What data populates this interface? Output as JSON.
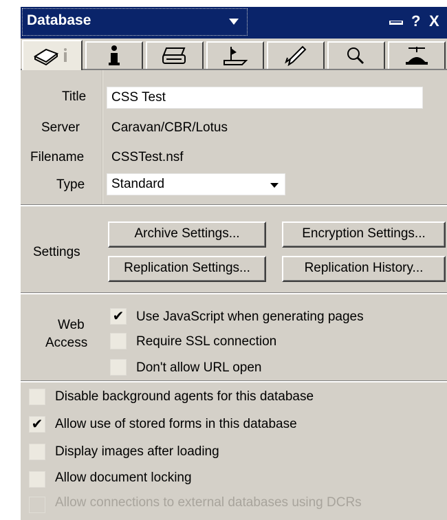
{
  "header": {
    "db_select": "Database",
    "help_glyph": "?",
    "close_glyph": "X"
  },
  "tabs": [
    {
      "name": "basics",
      "icon": "book-info-icon"
    },
    {
      "name": "info",
      "icon": "info-icon"
    },
    {
      "name": "print",
      "icon": "printer-icon"
    },
    {
      "name": "design",
      "icon": "design-icon"
    },
    {
      "name": "launch",
      "icon": "rocket-icon"
    },
    {
      "name": "fulltext",
      "icon": "magnifier-icon"
    },
    {
      "name": "advanced",
      "icon": "propeller-hat-icon"
    }
  ],
  "basics": {
    "title_label": "Title",
    "title_value": "CSS Test",
    "server_label": "Server",
    "server_value": "Caravan/CBR/Lotus",
    "filename_label": "Filename",
    "filename_value": "CSSTest.nsf",
    "type_label": "Type",
    "type_value": "Standard"
  },
  "settings": {
    "label": "Settings",
    "archive": "Archive Settings...",
    "encryption": "Encryption Settings...",
    "replication": "Replication Settings...",
    "history": "Replication History..."
  },
  "web_access": {
    "label_line1": "Web",
    "label_line2": "Access",
    "options": [
      {
        "label": "Use JavaScript when generating pages",
        "checked": true
      },
      {
        "label": "Require SSL connection",
        "checked": false
      },
      {
        "label": "Don't allow URL open",
        "checked": false
      }
    ]
  },
  "options": [
    {
      "label": "Disable background agents for this database",
      "checked": false,
      "enabled": true
    },
    {
      "label": "Allow use of stored forms in this database",
      "checked": true,
      "enabled": true
    },
    {
      "label": "Display images after loading",
      "checked": false,
      "enabled": true
    },
    {
      "label": "Allow document locking",
      "checked": false,
      "enabled": true
    },
    {
      "label": "Allow connections to external databases using DCRs",
      "checked": false,
      "enabled": false
    }
  ],
  "colors": {
    "titlebar": "#0a246a",
    "face": "#d4d0c8",
    "disabled_text": "#a8a49c"
  }
}
